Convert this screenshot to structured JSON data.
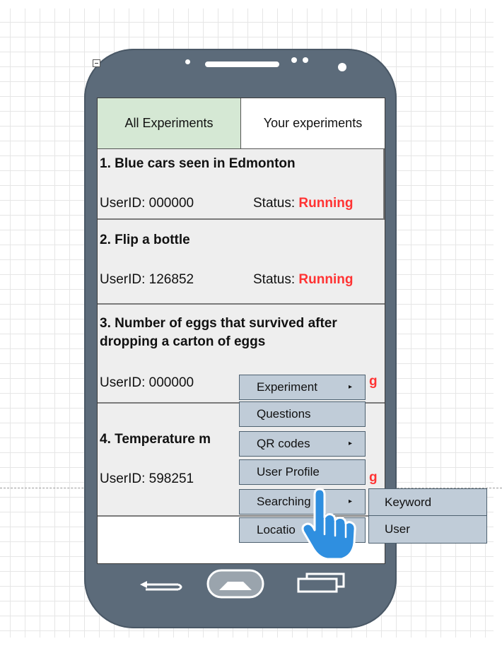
{
  "tabs": [
    {
      "label": "All Experiments",
      "active": true
    },
    {
      "label": "Your experiments",
      "active": false
    }
  ],
  "experiments": [
    {
      "title": "1. Blue cars seen in Edmonton",
      "user": "UserID: 000000",
      "status_label": "Status: ",
      "status": "Running"
    },
    {
      "title": "2. Flip a bottle",
      "user": "UserID: 126852",
      "status_label": "Status: ",
      "status": "Running"
    },
    {
      "title": "3. Number of eggs that survived after dropping a carton of eggs",
      "user": "UserID: 000000",
      "status_visible": "g"
    },
    {
      "title": "4. Temperature m",
      "user": "UserID: 598251",
      "status_visible": "g"
    }
  ],
  "menu": {
    "items": [
      {
        "label": "Experiment",
        "has_submenu": true
      },
      {
        "label": "Questions",
        "has_submenu": false
      },
      {
        "label": "QR codes",
        "has_submenu": true
      },
      {
        "label": "User Profile",
        "has_submenu": false
      },
      {
        "label": "Searching",
        "has_submenu": true
      },
      {
        "label": "Locatio",
        "has_submenu": false
      }
    ],
    "arrow_glyph": "▸"
  },
  "submenu": {
    "items": [
      {
        "label": "Keyword"
      },
      {
        "label": "User"
      }
    ]
  },
  "colors": {
    "phone_body": "#5c6b7a",
    "active_tab": "#d5e8d4",
    "status_running": "#ff3333",
    "menu_fill": "#c0ccd8",
    "cursor": "#2f8fe0"
  },
  "icons": [
    "back-icon",
    "home-icon",
    "recent-apps-icon",
    "hand-pointer-cursor-icon"
  ]
}
